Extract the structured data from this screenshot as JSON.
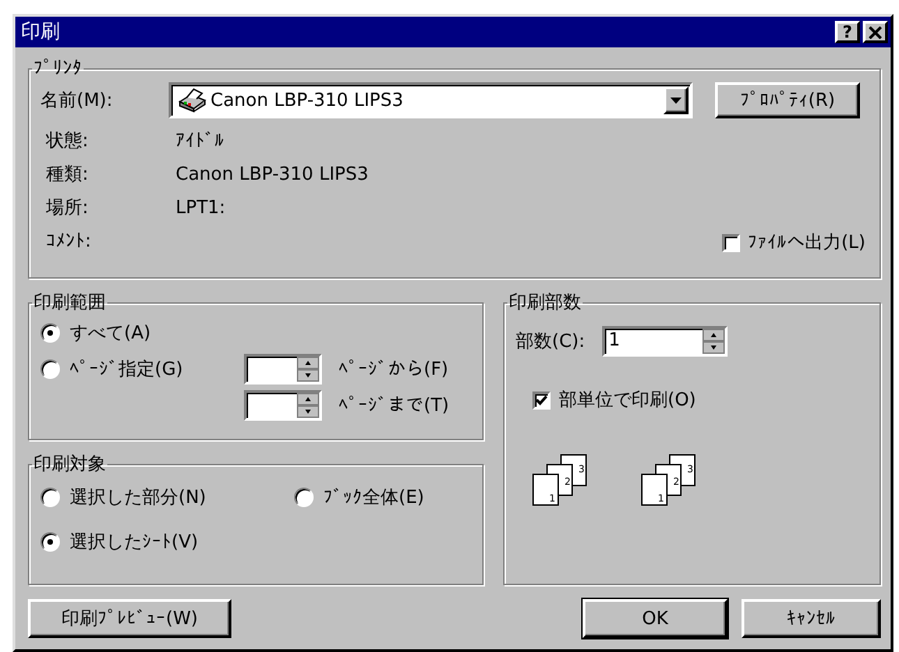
{
  "window": {
    "title": "印刷",
    "help_button": "?"
  },
  "printer": {
    "title": "ﾌﾟﾘﾝﾀ",
    "name_label": "名前(M):",
    "name_value": "Canon LBP-310 LIPS3",
    "properties_button": "ﾌﾟﾛﾊﾟﾃｨ(R)",
    "info": [
      {
        "label": "状態:",
        "value": "ｱｲﾄﾞﾙ"
      },
      {
        "label": "種類:",
        "value": "Canon LBP-310 LIPS3"
      },
      {
        "label": "場所:",
        "value": "LPT1:"
      },
      {
        "label": "ｺﾒﾝﾄ:"
      }
    ],
    "print_to_file": {
      "label": "ﾌｧｲﾙへ出力(L)",
      "checked": false
    }
  },
  "print_range": {
    "title": "印刷範囲",
    "options": [
      {
        "label": "すべて(A)",
        "selected": true
      },
      {
        "label": "ﾍﾟｰｼﾞ指定(G)",
        "selected": false
      }
    ],
    "from_label": "ﾍﾟｰｼﾞから(F)",
    "to_label": "ﾍﾟｰｼﾞまで(T)"
  },
  "copies": {
    "title": "印刷部数",
    "count_label": "部数(C):",
    "count_value": "1",
    "collate": {
      "label": "部単位で印刷(O)",
      "checked": true
    },
    "collate_icons": [
      {
        "pages": [
          "1",
          "2",
          "3"
        ]
      },
      {
        "pages": [
          "1",
          "2",
          "3"
        ]
      }
    ]
  },
  "print_target": {
    "title": "印刷対象",
    "options": [
      {
        "label": "選択した部分(N)",
        "selected": false
      },
      {
        "label": "ﾌﾞｯｸ全体(E)",
        "selected": false
      },
      {
        "label": "選択したｼｰﾄ(V)",
        "selected": true
      }
    ]
  },
  "buttons": [
    {
      "label": "印刷ﾌﾟﾚﾋﾞｭｰ(W)",
      "default": false
    },
    {
      "label": "OK",
      "default": true
    },
    {
      "label": "ｷｬﾝｾﾙ",
      "default": false
    }
  ]
}
